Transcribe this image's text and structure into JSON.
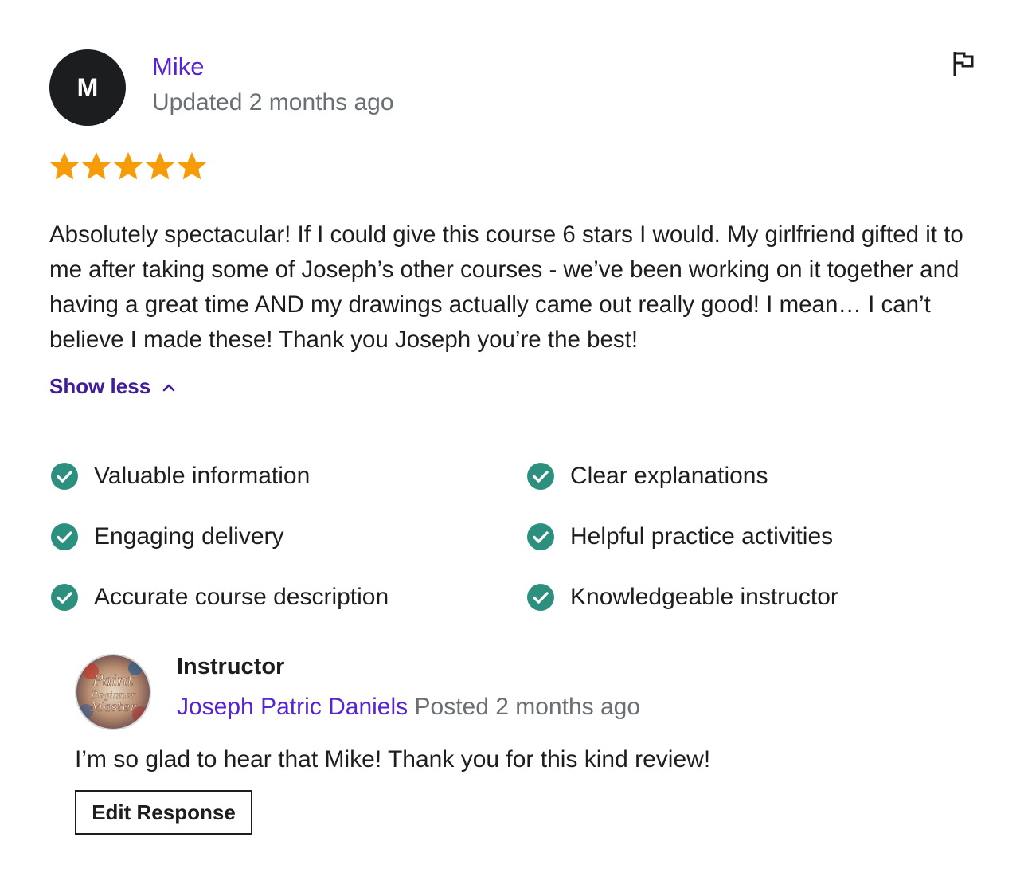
{
  "reviewer": {
    "initial": "M",
    "name": "Mike",
    "meta": "Updated 2 months ago"
  },
  "rating": {
    "value": 5,
    "max": 5,
    "star_color": "#f69c08"
  },
  "review": {
    "text": "Absolutely spectacular! If I could give this course 6 stars I would. My girlfriend gifted it to me after taking some of Joseph’s other courses - we’ve been working on it together and having a great time AND my drawings actually came out really good! I mean… I can’t believe I made these! Thank you Joseph you’re the best!",
    "toggle_label": "Show less",
    "toggle_icon": "chevron-up-icon"
  },
  "features": [
    {
      "label": "Valuable information"
    },
    {
      "label": "Clear explanations"
    },
    {
      "label": "Engaging delivery"
    },
    {
      "label": "Helpful practice activities"
    },
    {
      "label": "Accurate course description"
    },
    {
      "label": "Knowledgeable instructor"
    }
  ],
  "response": {
    "role": "Instructor",
    "name": "Joseph Patric Daniels",
    "posted": "Posted 2 months ago",
    "text": "I’m so glad to hear that Mike! Thank you for this kind review!",
    "edit_label": "Edit Response",
    "avatar_text": [
      "Paint",
      "Beginner",
      "Master"
    ]
  },
  "colors": {
    "accent": "#5624d0",
    "accent_dark": "#401b9c",
    "check_green": "#2d907f",
    "muted": "#6a6f73"
  }
}
